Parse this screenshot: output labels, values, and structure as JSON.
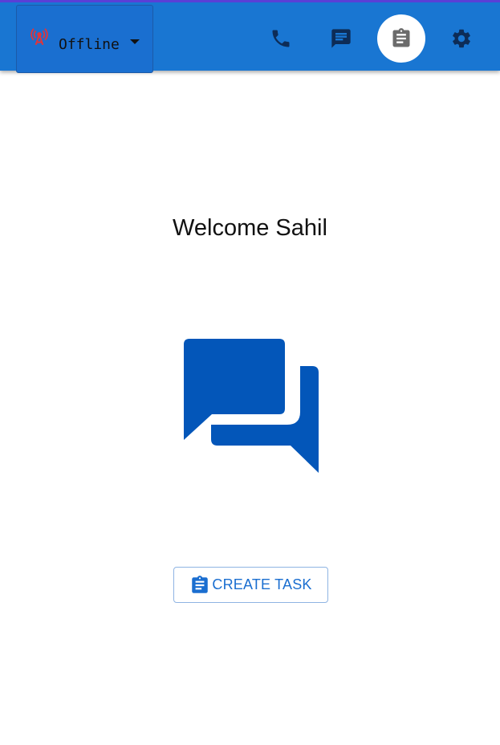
{
  "header": {
    "status": {
      "label": "Offline",
      "icon": "signal-tower-icon",
      "icon_color": "#e0353a",
      "options_visible": "Offline"
    },
    "nav": [
      {
        "name": "phone",
        "icon": "phone-icon",
        "active": false
      },
      {
        "name": "messages",
        "icon": "chat-icon",
        "active": false
      },
      {
        "name": "tasks",
        "icon": "clipboard-icon",
        "active": true
      },
      {
        "name": "settings",
        "icon": "gear-icon",
        "active": false
      }
    ],
    "bar_color": "#1976d2"
  },
  "main": {
    "welcome": "Welcome Sahil",
    "hero_icon": "forum-icon",
    "hero_color": "#0356b9",
    "create_task_label": "CREATE TASK",
    "create_task_icon": "clipboard-icon"
  }
}
